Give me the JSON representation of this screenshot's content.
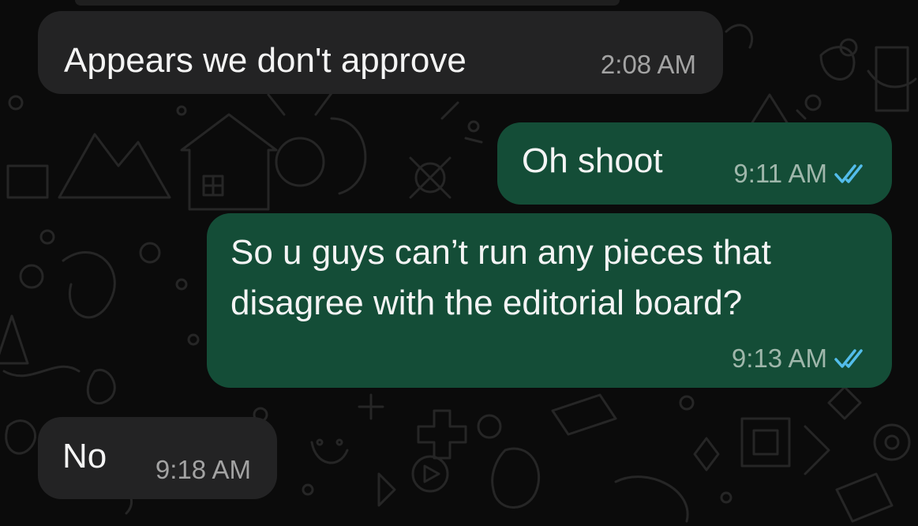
{
  "messages": [
    {
      "id": "m1",
      "direction": "incoming",
      "text": "Appears we don't approve",
      "time": "2:08 AM"
    },
    {
      "id": "m2",
      "direction": "outgoing",
      "text": "Oh shoot",
      "time": "9:11 AM",
      "status": "read"
    },
    {
      "id": "m3",
      "direction": "outgoing",
      "lines": [
        "So u guys can’t run any pieces that",
        "disagree with the editorial board?"
      ],
      "time": "9:13 AM",
      "status": "read"
    },
    {
      "id": "m4",
      "direction": "incoming",
      "text": "No",
      "time": "9:18 AM"
    }
  ],
  "colors": {
    "background": "#0b0b0b",
    "incoming_bubble": "#232324",
    "outgoing_bubble": "#144d37",
    "read_ticks": "#53bdeb"
  },
  "icons": {
    "read_receipt": "double-check-icon"
  }
}
